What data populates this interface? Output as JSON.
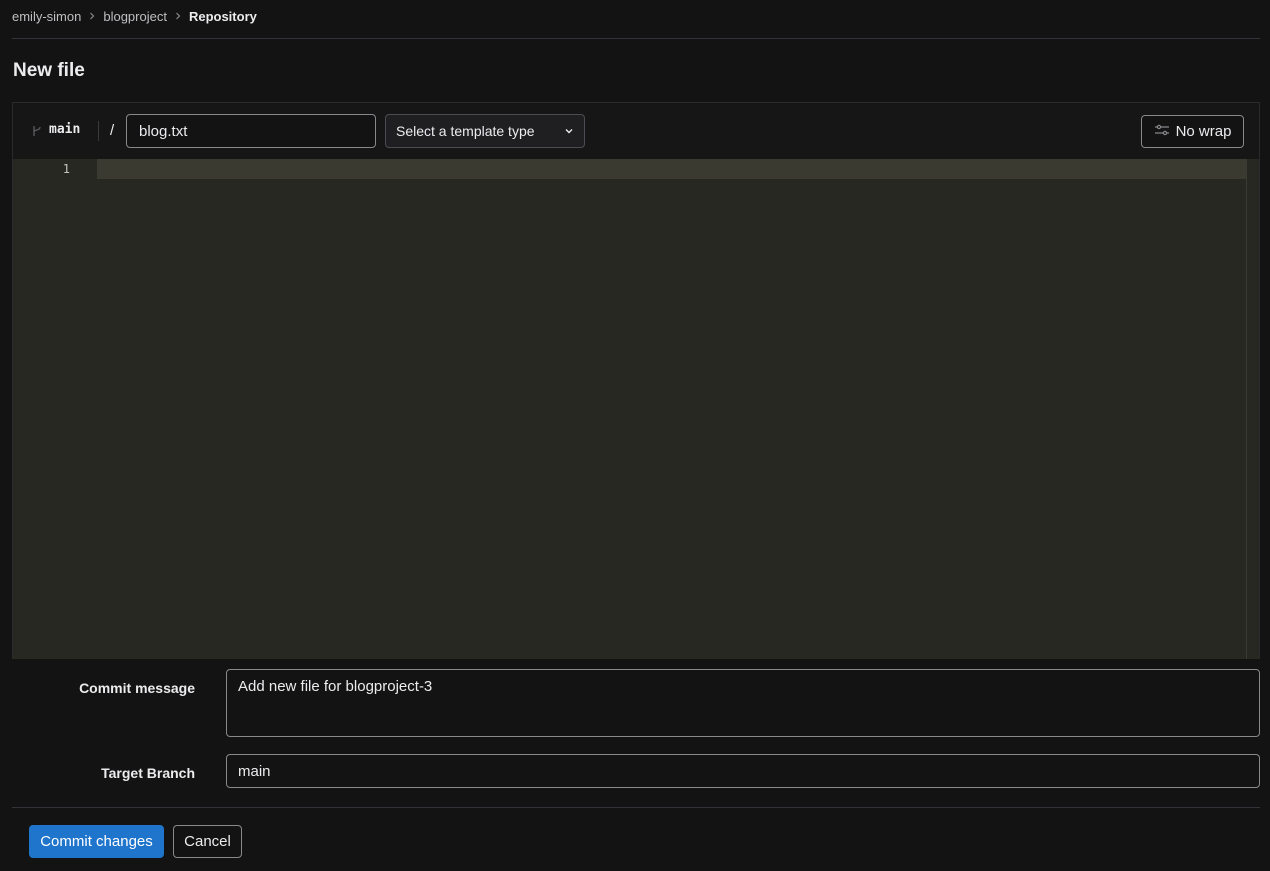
{
  "breadcrumb": {
    "items": [
      {
        "label": "emily-simon"
      },
      {
        "label": "blogproject"
      },
      {
        "label": "Repository"
      }
    ]
  },
  "page": {
    "title": "New file"
  },
  "editor": {
    "branch": "main",
    "path_separator": "/",
    "filename": "blog.txt",
    "template_select": "Select a template type",
    "wrap_button": "No wrap",
    "line_numbers": [
      "1"
    ]
  },
  "form": {
    "commit_message_label": "Commit message",
    "commit_message_value": "Add new file for blogproject-3",
    "target_branch_label": "Target Branch",
    "target_branch_value": "main"
  },
  "actions": {
    "commit_label": "Commit changes",
    "cancel_label": "Cancel"
  },
  "colors": {
    "background": "#131313",
    "editor_background": "#272822",
    "primary": "#1f75cb"
  },
  "icons": [
    "chevron-right-icon",
    "branch-icon",
    "chevron-down-icon",
    "wrap-icon"
  ]
}
